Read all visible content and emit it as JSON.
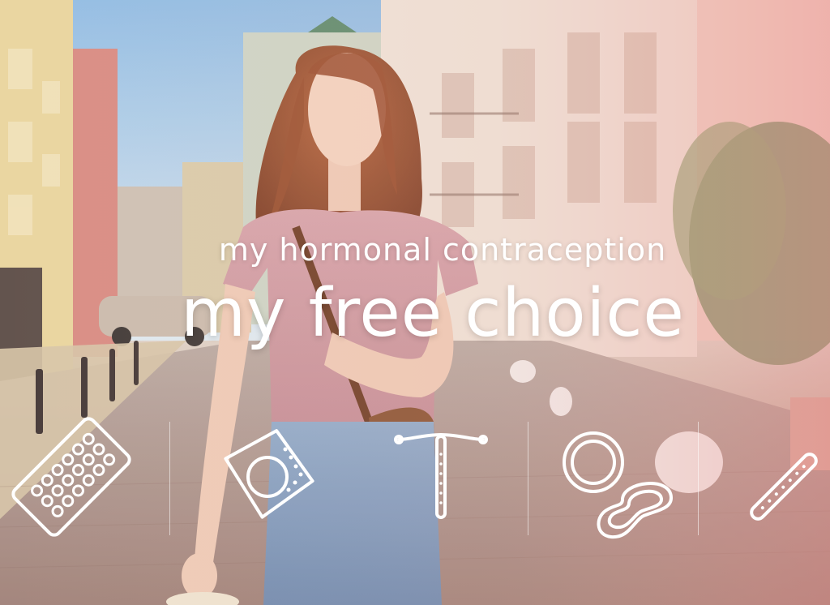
{
  "headline": {
    "line1": "my hormonal contraception",
    "line2": "my free choice"
  },
  "icons": [
    "pill-blister-pack-icon",
    "contraceptive-patch-icon",
    "iud-icon",
    "vaginal-ring-icon",
    "implant-rod-icon"
  ],
  "colors": {
    "overlay_text": "#ffffff",
    "warm_tint": "#e88f8a"
  }
}
